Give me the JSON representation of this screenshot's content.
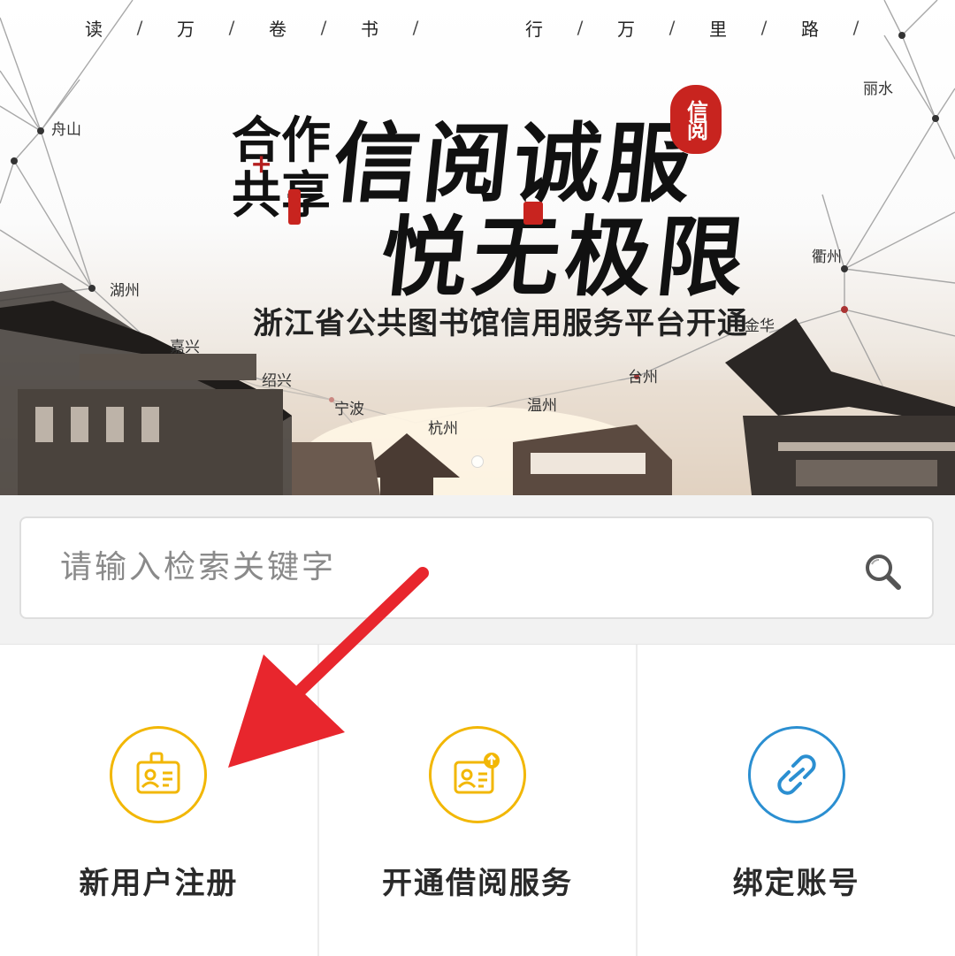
{
  "banner": {
    "slogan_left": [
      "读",
      "万",
      "卷",
      "书"
    ],
    "slogan_right": [
      "行",
      "万",
      "里",
      "路"
    ],
    "title_line1": "信阅诚服",
    "title_line2": "悦无极限",
    "coop_top": "合作",
    "coop_plus": "+",
    "coop_bottom": "共享",
    "seal_text": "信阅",
    "subtitle": "浙江省公共图书馆信用服务平台开通",
    "cities": {
      "zhoushan": "舟山",
      "lishui": "丽水",
      "huzhou": "湖州",
      "quzhou": "衢州",
      "jiaxing": "嘉兴",
      "jinhua": "金华",
      "shaoxing": "绍兴",
      "taizhou": "台州",
      "ningbo": "宁波",
      "wenzhou": "温州",
      "hangzhou": "杭州"
    }
  },
  "search": {
    "placeholder": "请输入检索关键字",
    "icon": "search-icon"
  },
  "actions": [
    {
      "label": "新用户注册",
      "icon": "id-card-lock-icon",
      "color": "#f2b705"
    },
    {
      "label": "开通借阅服务",
      "icon": "id-card-upload-icon",
      "color": "#f2b705"
    },
    {
      "label": "绑定账号",
      "icon": "link-icon",
      "color": "#2b8fd1"
    }
  ],
  "colors": {
    "accent_yellow": "#f2b705",
    "accent_blue": "#2b8fd1",
    "annotation_arrow": "#e8262d",
    "seal_red": "#c8241f"
  }
}
